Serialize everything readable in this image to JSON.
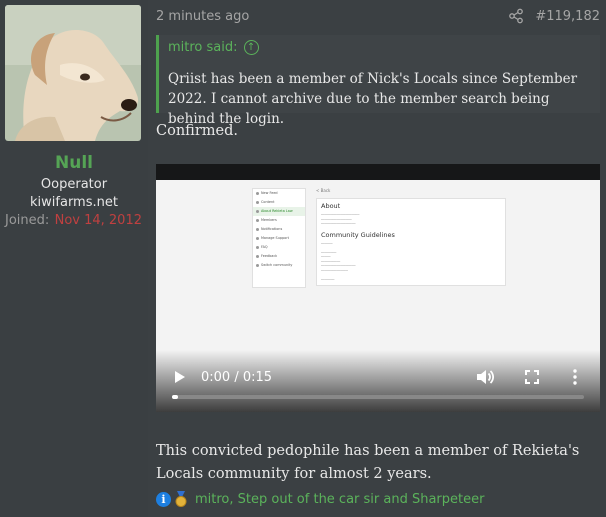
{
  "author": {
    "username": "Null",
    "title_line1": "Ooperator",
    "title_line2": "kiwifarms.net",
    "joined_label": "Joined:",
    "joined_value": "Nov 14, 2012"
  },
  "post": {
    "time": "2 minutes ago",
    "post_number": "#119,182",
    "share_icon": "share-icon",
    "quote": {
      "attribution": "mitro said:",
      "text": "Qriist has been a member of Nick's Locals since September 2022. I cannot archive due to the member search being behind the login."
    },
    "confirmed": "Confirmed.",
    "body": "This convicted pedophile has been a member of Rekieta's Locals community for almost 2 years."
  },
  "video": {
    "time_display": "0:00 / 0:15",
    "progress_fraction": 0.0,
    "screenshot": {
      "nav_items": [
        "New Feed",
        "Content",
        "About Rekieta Law",
        "Members",
        "Notifications",
        "Manage Support",
        "FAQ",
        "Feedback",
        "Switch community"
      ],
      "active_index": 2,
      "back": "< Back",
      "about_heading": "About",
      "guidelines_heading": "Community Guidelines"
    }
  },
  "reactions": {
    "icons": [
      "informative-icon",
      "gold-medal-icon"
    ],
    "users": "mitro, Step out of the car sir and Sharpeteer"
  },
  "colors": {
    "background": "#3b4043",
    "username": "#55a455",
    "joined_date": "#c04040",
    "quote_border": "#4ea24e",
    "reaction_link": "#5bb35b"
  }
}
